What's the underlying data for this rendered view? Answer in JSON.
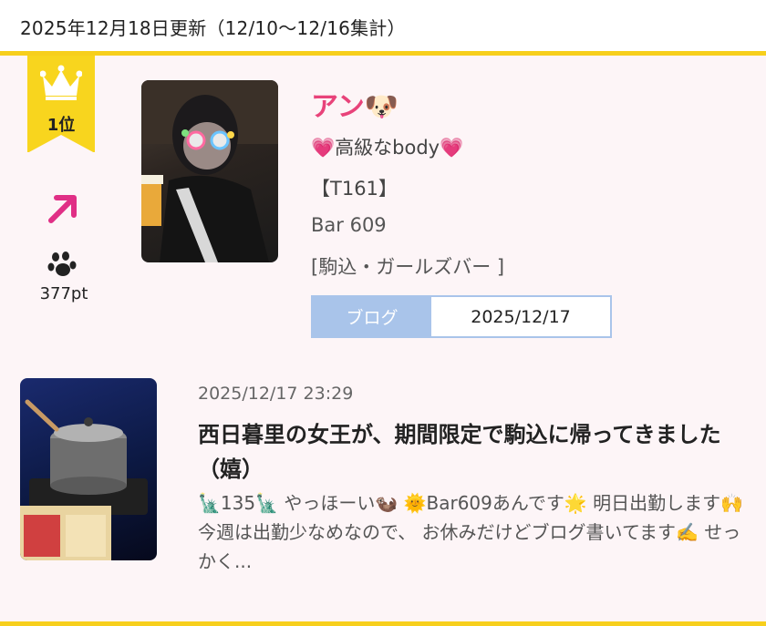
{
  "header": {
    "title": "2025年12月18日更新（12/10〜12/16集計）"
  },
  "rank": {
    "label": "1位",
    "points": "377pt",
    "trend_icon": "arrow-up-right-icon"
  },
  "profile": {
    "name": "アン🐶",
    "catchphrase": "💗高級なbody💗",
    "height": "【T161】",
    "shop": "Bar 609",
    "area": "[駒込・ガールズバー ]"
  },
  "blog": {
    "tag": "ブログ",
    "date": "2025/12/17"
  },
  "post": {
    "datetime": "2025/12/17 23:29",
    "title": "西日暮里の女王が、期間限定で駒込に帰ってきました（嬉）",
    "excerpt": "🗽135🗽 やっほーい🦦 🌞Bar609あんです🌟 明日出勤します🙌 今週は出勤少なめなので、 お休みだけどブログ書いてます✍️ せっかく..."
  },
  "colors": {
    "accent_yellow": "#f7cf1c",
    "name_pink": "#e8437a",
    "blog_blue": "#a9c4ea",
    "background": "#fdf5f7"
  }
}
